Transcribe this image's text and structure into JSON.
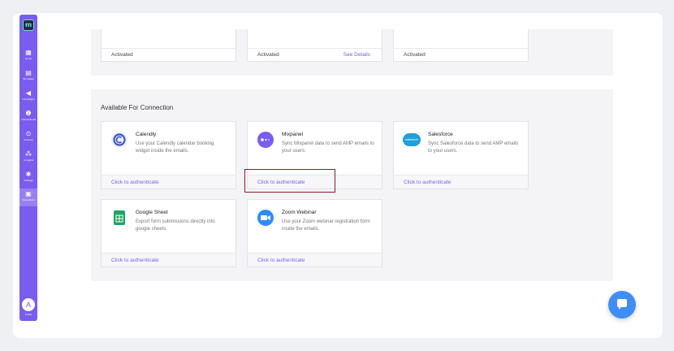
{
  "sidebar": {
    "logo_text": "m",
    "items": [
      {
        "id": "home",
        "label": "Home",
        "glyph": "▦"
      },
      {
        "id": "templates",
        "label": "Templates",
        "glyph": "▤"
      },
      {
        "id": "campaigns",
        "label": "Campaigns",
        "glyph": "◀"
      },
      {
        "id": "transactional",
        "label": "Transactional",
        "glyph": "❶"
      },
      {
        "id": "journey",
        "label": "Journey",
        "glyph": "⊙"
      },
      {
        "id": "contacts",
        "label": "Contacts",
        "glyph": "⁂"
      },
      {
        "id": "settings",
        "label": "Settings",
        "glyph": "✱"
      },
      {
        "id": "integrations",
        "label": "Integrations",
        "glyph": "▣",
        "active": true
      }
    ],
    "avatar_initial": "A",
    "avatar_label": "Profile"
  },
  "activated": [
    {
      "status": "Activated",
      "link": ""
    },
    {
      "status": "Activated",
      "link": "See Details"
    },
    {
      "status": "Activated",
      "link": ""
    }
  ],
  "available": {
    "title": "Available For Connection",
    "cards": [
      {
        "name": "Calendly",
        "desc": "Use your Calendly calendar booking widget inside the emails.",
        "action": "Click to authenticate",
        "icon": "calendly-icon"
      },
      {
        "name": "Mixpanel",
        "desc": "Sync Mixpanel data to send AMP emails to your users.",
        "action": "Click to authenticate",
        "icon": "mixpanel-icon"
      },
      {
        "name": "Salesforce",
        "desc": "Sync Salesforce data to send AMP emails to your users.",
        "action": "Click to authenticate",
        "icon": "salesforce-icon",
        "logo_text": "salesforce"
      },
      {
        "name": "Google Sheet",
        "desc": "Export form submissions directly into google sheets.",
        "action": "Click to authenticate",
        "icon": "google-sheet-icon"
      },
      {
        "name": "Zoom Webinar",
        "desc": "Use your Zoom webinar registration form inside the emails.",
        "action": "Click to authenticate",
        "icon": "zoom-icon"
      }
    ]
  },
  "colors": {
    "accent": "#7b5cf0",
    "highlight": "#8b1a2b",
    "chat": "#3f8ef7"
  }
}
